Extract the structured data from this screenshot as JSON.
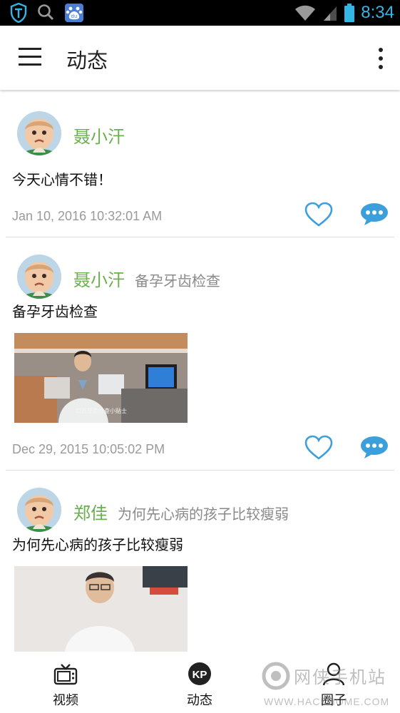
{
  "status_bar": {
    "time": "8:34",
    "icons": [
      "shield-icon",
      "search-icon",
      "baidu-icon",
      "wifi-icon",
      "signal-icon",
      "battery-icon"
    ]
  },
  "app_bar": {
    "title": "动态",
    "icons": [
      "menu-icon",
      "more-vertical-icon"
    ]
  },
  "colors": {
    "accent_green": "#6ab04c",
    "icon_blue": "#3b9fdc",
    "status_blue": "#33b5e5"
  },
  "posts": [
    {
      "author": "聂小汗",
      "topic": "",
      "text": "今天心情不错！",
      "timestamp": "Jan 10, 2016 10:32:01 AM",
      "has_image": false
    },
    {
      "author": "聂小汗",
      "topic": "备孕牙齿检查",
      "text": "备孕牙齿检查",
      "timestamp": "Dec 29, 2015 10:05:02 PM",
      "has_image": true
    },
    {
      "author": "郑佳",
      "topic": "为何先心病的孩子比较瘦弱",
      "text": "为何先心病的孩子比较瘦弱",
      "has_image": true
    }
  ],
  "bottom_nav": [
    {
      "label": "视频",
      "icon": "tv-icon"
    },
    {
      "label": "动态",
      "icon": "kp-icon"
    },
    {
      "label": "圈子",
      "icon": "person-icon"
    }
  ],
  "watermark": {
    "text": "网侠手机站",
    "url": "WWW.HACKHOME.COM"
  }
}
